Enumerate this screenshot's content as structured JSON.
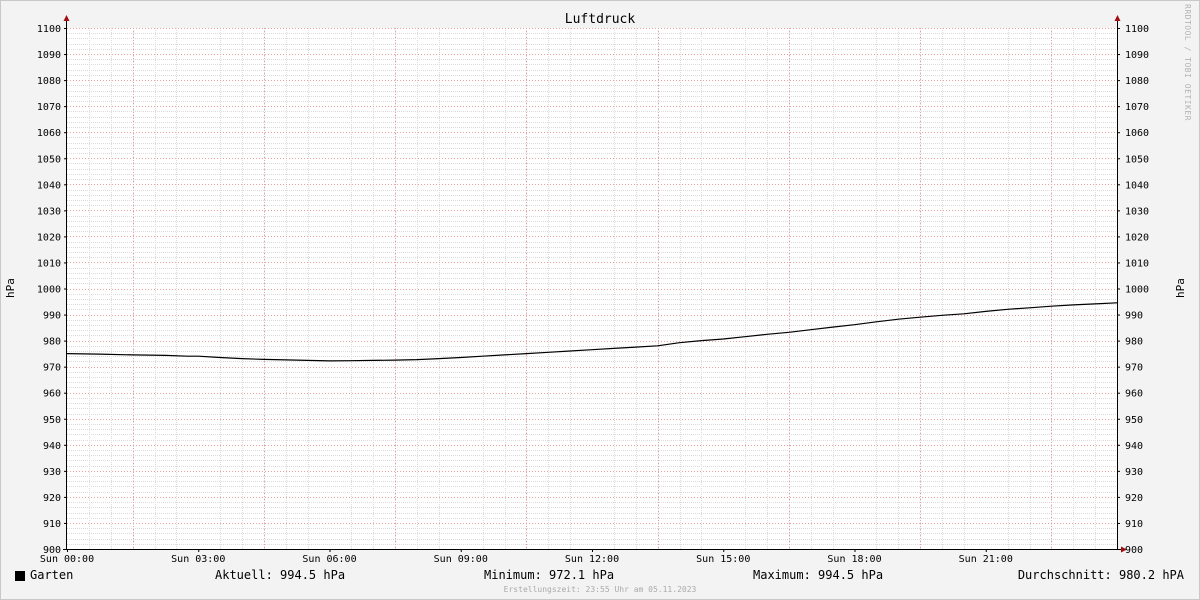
{
  "chart_data": {
    "type": "line",
    "title": "Luftdruck",
    "ylabel_left": "hPa",
    "ylabel_right": "hPa",
    "ylim": [
      900,
      1100
    ],
    "y_ticks": [
      "900",
      "910",
      "920",
      "930",
      "940",
      "950",
      "960",
      "970",
      "980",
      "990",
      "1000",
      "1010",
      "1020",
      "1030",
      "1040",
      "1050",
      "1060",
      "1070",
      "1080",
      "1090",
      "1100"
    ],
    "xlim_hours": [
      0,
      24
    ],
    "x_ticks": [
      {
        "label": "Sun 00:00",
        "hour": 0
      },
      {
        "label": "Sun 03:00",
        "hour": 3
      },
      {
        "label": "Sun 06:00",
        "hour": 6
      },
      {
        "label": "Sun 09:00",
        "hour": 9
      },
      {
        "label": "Sun 12:00",
        "hour": 12
      },
      {
        "label": "Sun 15:00",
        "hour": 15
      },
      {
        "label": "Sun 18:00",
        "hour": 18
      },
      {
        "label": "Sun 21:00",
        "hour": 21
      }
    ],
    "series": [
      {
        "name": "Garten",
        "color": "#000000",
        "x_hours": [
          0,
          0.75,
          1.5,
          2.25,
          2.75,
          3,
          3.5,
          4,
          4.5,
          5,
          5.5,
          6,
          6.5,
          7,
          7.5,
          8,
          8.5,
          9,
          9.5,
          10,
          10.5,
          11,
          11.5,
          12,
          12.5,
          13,
          13.5,
          14,
          14.5,
          15,
          15.5,
          16,
          16.5,
          17,
          17.5,
          18,
          18.5,
          19,
          19.5,
          20,
          20.5,
          21,
          21.5,
          22,
          22.5,
          23,
          23.5,
          24
        ],
        "values": [
          975.0,
          974.8,
          974.5,
          974.3,
          974.0,
          974.0,
          973.5,
          973.1,
          972.8,
          972.6,
          972.4,
          972.2,
          972.3,
          972.4,
          972.5,
          972.7,
          973.1,
          973.5,
          974.0,
          974.5,
          975.0,
          975.5,
          976.0,
          976.5,
          977.0,
          977.5,
          978.0,
          979.2,
          980.0,
          980.6,
          981.5,
          982.4,
          983.2,
          984.2,
          985.2,
          986.1,
          987.2,
          988.2,
          989.0,
          989.7,
          990.3,
          991.2,
          992.0,
          992.6,
          993.2,
          993.7,
          994.1,
          994.5
        ]
      }
    ],
    "grid": true,
    "legend": "bottom-left"
  },
  "legend": {
    "series_name": "Garten",
    "current": "Aktuell: 994.5 hPa",
    "minimum": "Minimum: 972.1 hPa",
    "maximum": "Maximum: 994.5 hPa",
    "average": "Durchschnitt: 980.2 hPA"
  },
  "footer": "Erstellungszeit: 23:55 Uhr am 05.11.2023",
  "watermark": "RRDTOOL / TOBI OETIKER",
  "colors": {
    "background": "#f3f3f3",
    "plot_background": "#ffffff",
    "minor_grid": "#dcdcdc",
    "major_grid": "#e8a0a0",
    "axis_arrow": "#a01010",
    "line": "#000000"
  }
}
